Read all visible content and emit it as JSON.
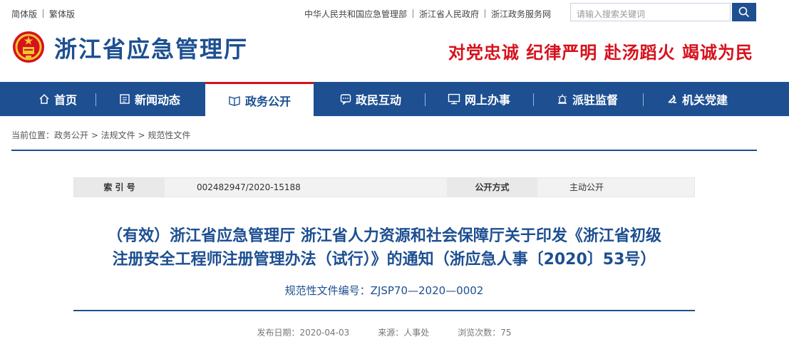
{
  "topbar": {
    "lang_simplified": "简体版",
    "lang_traditional": "繁体版",
    "links": [
      "中华人民共和国应急管理部",
      "浙江省人民政府",
      "浙江政务服务网"
    ],
    "search_placeholder": "请输入搜索关键词",
    "search_icon": "search-icon"
  },
  "header": {
    "site_title": "浙江省应急管理厅",
    "slogan": "对党忠诚 纪律严明 赴汤蹈火 竭诚为民",
    "brand_color": "#1d4f91",
    "slogan_color": "#d6121c"
  },
  "nav": {
    "items": [
      {
        "label": "首页",
        "icon": "home-icon"
      },
      {
        "label": "新闻动态",
        "icon": "news-icon"
      },
      {
        "label": "政务公开",
        "icon": "book-icon",
        "active": true
      },
      {
        "label": "政民互动",
        "icon": "chat-icon"
      },
      {
        "label": "网上办事",
        "icon": "monitor-icon"
      },
      {
        "label": "派驻监督",
        "icon": "alarm-icon"
      },
      {
        "label": "机关党建",
        "icon": "party-icon"
      }
    ]
  },
  "breadcrumb": {
    "text": "当前位置：政务公开 > 法规文件 > 规范性文件"
  },
  "meta": {
    "index_label": "索 引 号",
    "index_value": "002482947/2020-15188",
    "method_label": "公开方式",
    "method_value": "主动公开"
  },
  "article": {
    "title_line1": "（有效）浙江省应急管理厅 浙江省人力资源和社会保障厅关于印发《浙江省初级",
    "title_line2": "注册安全工程师注册管理办法（试行）》的通知（浙应急人事〔2020〕53号）",
    "doc_no": "规范性文件编号：ZJSP70—2020—0002",
    "publish_date": "发布日期：2020-04-03",
    "source": "来源：人事处",
    "views": "浏览次数：75"
  }
}
